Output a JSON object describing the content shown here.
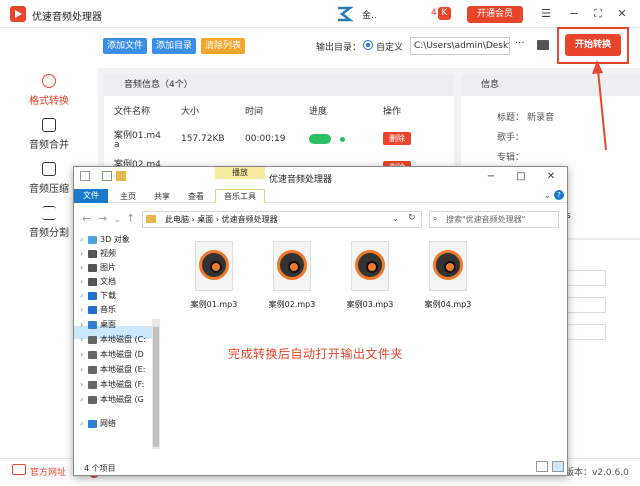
{
  "app": {
    "title": "优速音频处理器",
    "user": "金..",
    "count": "4",
    "vip": "开通会员"
  },
  "window_controls": {
    "menu": "☰",
    "minimize": "−",
    "maximize": "⛶",
    "close": "✕"
  },
  "sidebar": {
    "items": [
      {
        "label": "格式转换",
        "active": true
      },
      {
        "label": "音频合并"
      },
      {
        "label": "音频压缩"
      },
      {
        "label": "音频分割"
      }
    ]
  },
  "toolbar": {
    "add_file": "添加文件",
    "add_dir": "添加目录",
    "clear": "清除列表",
    "output_label": "输出目录：",
    "radio_label": "自定义",
    "path": "C:\\Users\\admin\\Deskto",
    "more": "···",
    "start": "开始转换"
  },
  "panel": {
    "title": "音频信息（4个）",
    "columns": [
      "文件名称",
      "大小",
      "时间",
      "进度",
      "操作"
    ],
    "rows": [
      {
        "name": "案例01.m4",
        "name2": "a",
        "size": "157.72KB",
        "time": "00:00:19",
        "action": "删除"
      },
      {
        "name": "案例02.m4",
        "action": "删除"
      }
    ]
  },
  "info": {
    "title": "信息",
    "fields": [
      {
        "label": "标题：",
        "value": "新录音"
      },
      {
        "label": "歌手：",
        "value": ""
      },
      {
        "label": "专辑：",
        "value": ""
      }
    ],
    "partial": "s"
  },
  "footer": {
    "website": "官方网址",
    "version": "版本：v2.0.6.0"
  },
  "explorer": {
    "title": "优速音频处理器",
    "play_tab": "播放",
    "ribbon_tabs": [
      "文件",
      "主页",
      "共享",
      "查看",
      "音乐工具"
    ],
    "address": [
      "此电脑",
      "桌面",
      "优速音频处理器"
    ],
    "search_placeholder": "搜索\"优速音频处理器\"",
    "nav": [
      {
        "label": "3D 对象",
        "color": "#4aa3df"
      },
      {
        "label": "视频",
        "color": "#555"
      },
      {
        "label": "图片",
        "color": "#555"
      },
      {
        "label": "文档",
        "color": "#555"
      },
      {
        "label": "下载",
        "color": "#1e6fd0"
      },
      {
        "label": "音乐",
        "color": "#1e6fd0"
      },
      {
        "label": "桌面",
        "color": "#2f7fd1",
        "selected": true
      },
      {
        "label": "本地磁盘 (C:",
        "color": "#666"
      },
      {
        "label": "本地磁盘 (D",
        "color": "#666"
      },
      {
        "label": "本地磁盘 (E:",
        "color": "#666"
      },
      {
        "label": "本地磁盘 (F:",
        "color": "#666"
      },
      {
        "label": "本地磁盘 (G",
        "color": "#666"
      },
      {
        "label": "网络",
        "color": "#2f7fd1"
      }
    ],
    "files": [
      "案例01.mp3",
      "案例02.mp3",
      "案例03.mp3",
      "案例04.mp3"
    ],
    "status": "4 个项目",
    "annotation": "完成转换后自动打开输出文件夹"
  }
}
